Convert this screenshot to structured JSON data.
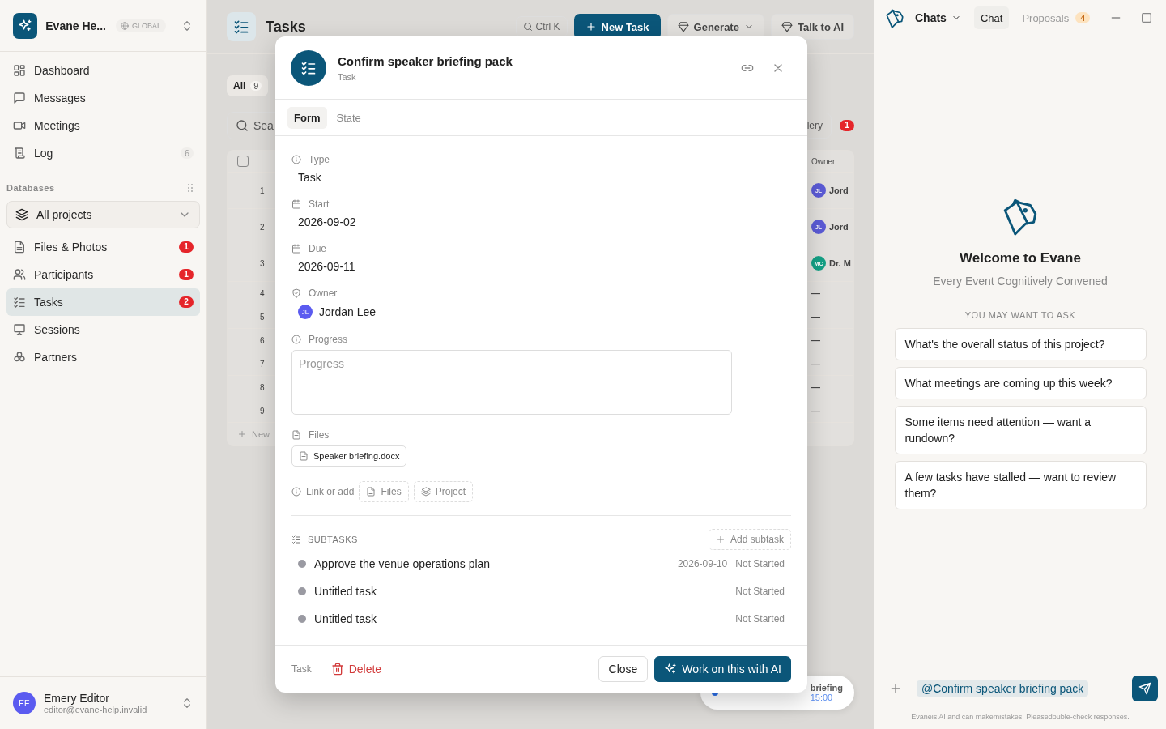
{
  "sidebar": {
    "workspace": {
      "name": "Evane He...",
      "scope": "GLOBAL"
    },
    "nav": [
      {
        "label": "Dashboard",
        "selected": false
      },
      {
        "label": "Messages",
        "selected": false
      },
      {
        "label": "Meetings",
        "selected": false
      },
      {
        "label": "Log",
        "count": "6",
        "selected": false
      }
    ],
    "section_title": "Databases",
    "project_select": "All projects",
    "databases": [
      {
        "label": "Files & Photos",
        "badge": "1",
        "selected": false
      },
      {
        "label": "Participants",
        "badge": "1",
        "selected": false
      },
      {
        "label": "Tasks",
        "badge": "2",
        "selected": true
      },
      {
        "label": "Sessions",
        "selected": false
      },
      {
        "label": "Partners",
        "selected": false
      }
    ],
    "user": {
      "initials": "EE",
      "name": "Emery Editor",
      "email": "editor@evane-help.invalid"
    }
  },
  "main": {
    "title": "Tasks",
    "search_shortcut": "Ctrl K",
    "new_button": "New Task",
    "generate_button": "Generate",
    "talk_button": "Talk to AI",
    "filter": {
      "label": "All",
      "count": "9"
    },
    "search_placeholder": "Sea",
    "view_button": "lery",
    "view_badge": "1",
    "table": {
      "select_all_checked": false,
      "owner_column": "Owner",
      "rows": [
        {
          "number": "1",
          "owner": {
            "initials": "JL",
            "name": "Jord",
            "color": "#5b5bd6"
          }
        },
        {
          "number": "2",
          "owner": {
            "initials": "JL",
            "name": "Jord",
            "color": "#5b5bd6"
          }
        },
        {
          "number": "3",
          "owner": {
            "initials": "MC",
            "name": "Dr. M",
            "color": "#14a085"
          }
        },
        {
          "number": "4",
          "empty": "—"
        },
        {
          "number": "5",
          "empty": "—"
        },
        {
          "number": "6",
          "empty": "—"
        },
        {
          "number": "7",
          "empty": "—"
        },
        {
          "number": "8",
          "empty": "—"
        },
        {
          "number": "9",
          "empty": "—"
        }
      ],
      "add_row": "New"
    },
    "toast": {
      "title": "briefing",
      "time": "15:00"
    }
  },
  "modal": {
    "title": "Confirm speaker briefing pack",
    "subtitle": "Task",
    "tabs": [
      {
        "label": "Form",
        "selected": true
      },
      {
        "label": "State",
        "selected": false
      }
    ],
    "fields": [
      {
        "kind": "text",
        "label": "Type",
        "value": "Task"
      },
      {
        "kind": "date",
        "label": "Start",
        "value": "2026-09-02"
      },
      {
        "kind": "date",
        "label": "Due",
        "value": "2026-09-11"
      },
      {
        "kind": "person",
        "label": "Owner",
        "value": "Jordan Lee",
        "initials": "JL",
        "color": "#5b5bf0"
      },
      {
        "kind": "textarea",
        "label": "Progress",
        "placeholder": "Progress"
      },
      {
        "kind": "files",
        "label": "Files",
        "files": [
          "Speaker briefing.docx"
        ]
      }
    ],
    "link_or_add": {
      "label": "Link or add",
      "options": [
        "Files",
        "Project"
      ]
    },
    "subtasks": {
      "title": "SUBTASKS",
      "add_button": "Add subtask",
      "items": [
        {
          "title": "Approve the venue operations plan",
          "due": "2026-09-10",
          "status": "Not Started"
        },
        {
          "title": "Untitled task",
          "status": "Not Started"
        },
        {
          "title": "Untitled task",
          "status": "Not Started"
        }
      ]
    },
    "footer": {
      "kind_label": "Task",
      "delete_button": "Delete",
      "close_button": "Close",
      "primary_button": "Work on this with AI"
    }
  },
  "chat_panel": {
    "menu": "Chats",
    "tabs": [
      {
        "label": "Chat",
        "selected": true
      },
      {
        "label": "Proposals",
        "badge": "4",
        "selected": false
      }
    ],
    "welcome_title": "Welcome to Evane",
    "tagline": "Every Event Cognitively Convened",
    "suggestions_title": "YOU MAY WANT TO ASK",
    "suggestions": [
      "What's the overall status of this project?",
      "What meetings are coming up this week?",
      "Some items need attention — want a rundown?",
      "A few tasks have stalled — want to review them?"
    ],
    "mention": "@Confirm speaker briefing pack",
    "disclaimer": "Evaneis AI and can makemistakes. Pleasedouble-check responses."
  }
}
